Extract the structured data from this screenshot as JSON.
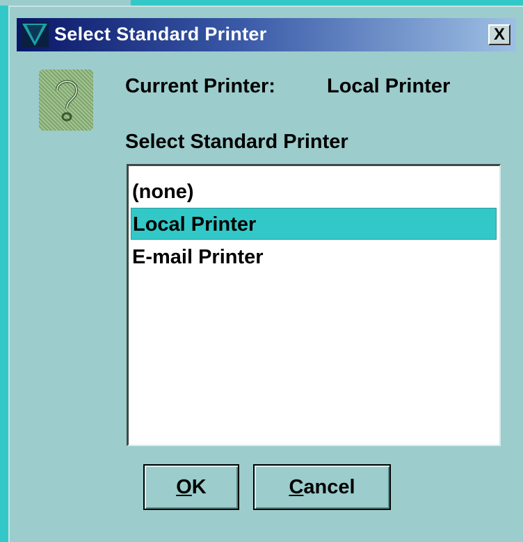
{
  "window": {
    "title": "Select Standard Printer",
    "close_glyph": "X",
    "logo_icon": "app-logo-icon"
  },
  "current": {
    "label": "Current Printer:",
    "value": "Local Printer"
  },
  "select": {
    "label": "Select Standard Printer"
  },
  "list": {
    "items": [
      {
        "label": "(none)",
        "selected": false
      },
      {
        "label": "Local Printer",
        "selected": true
      },
      {
        "label": "E-mail Printer",
        "selected": false
      }
    ]
  },
  "buttons": {
    "ok": {
      "mnemonic": "O",
      "rest": "K"
    },
    "cancel": {
      "mnemonic": "C",
      "rest": "ancel"
    }
  },
  "colors": {
    "background": "#33c8c8",
    "dialog": "#9ccccc",
    "selection": "#33c8c8",
    "title_start": "#0a1668",
    "title_end": "#9ec0e4"
  },
  "icons": {
    "help": "question-mark-icon",
    "close": "close-icon"
  }
}
